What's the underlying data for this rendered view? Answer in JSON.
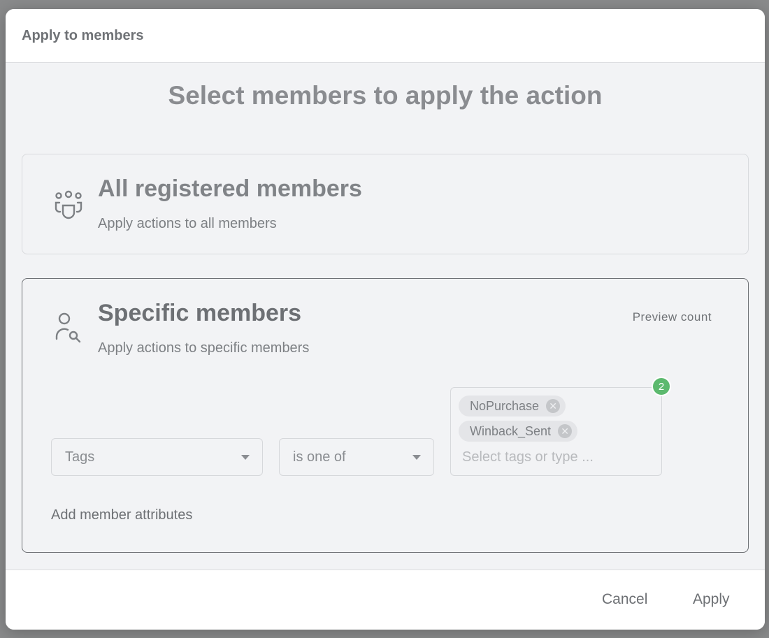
{
  "modal": {
    "header_title": "Apply to members",
    "section_title": "Select members to apply the action"
  },
  "options": {
    "all": {
      "icon": "group-icon",
      "title": "All registered members",
      "description": "Apply actions to all members"
    },
    "specific": {
      "icon": "person-search-icon",
      "title": "Specific members",
      "description": "Apply actions to specific members",
      "preview_label": "Preview count"
    }
  },
  "filter": {
    "field_value": "Tags",
    "operator_value": "is one of",
    "tags": [
      {
        "label": "NoPurchase"
      },
      {
        "label": "Winback_Sent"
      }
    ],
    "tag_placeholder": "Select tags or type ...",
    "selected_count": "2",
    "add_attributes_label": "Add member attributes"
  },
  "footer": {
    "cancel_label": "Cancel",
    "apply_label": "Apply"
  },
  "colors": {
    "badge": "#5cb96e",
    "card_selected_border": "#6d7074"
  }
}
